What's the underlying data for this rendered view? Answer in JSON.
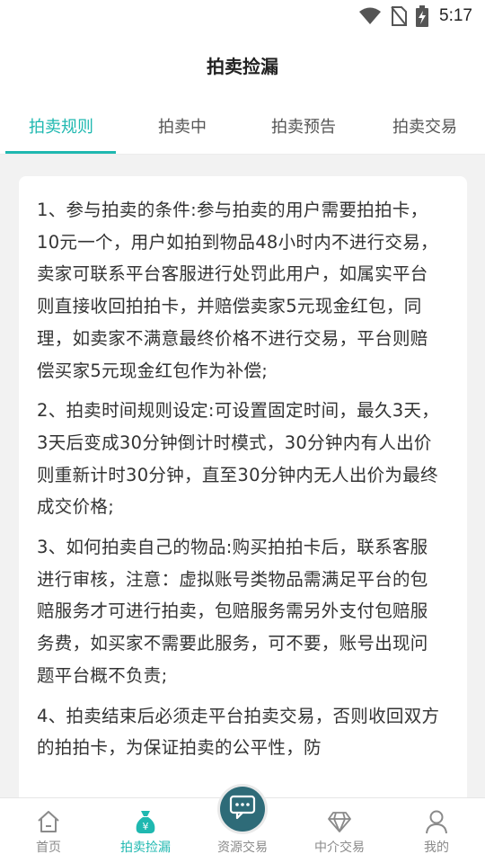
{
  "status_bar": {
    "time": "5:17",
    "icons": [
      "wifi-icon",
      "no-sim-icon",
      "battery-charging-icon"
    ]
  },
  "header": {
    "title": "拍卖捡漏"
  },
  "tabs": [
    {
      "label": "拍卖规则",
      "active": true
    },
    {
      "label": "拍卖中",
      "active": false
    },
    {
      "label": "拍卖预告",
      "active": false
    },
    {
      "label": "拍卖交易",
      "active": false
    }
  ],
  "rules": [
    "1、参与拍卖的条件:参与拍卖的用户需要拍拍卡，10元一个，用户如拍到物品48小时内不进行交易，卖家可联系平台客服进行处罚此用户，如属实平台则直接收回拍拍卡，并赔偿卖家5元现金红包，同理，如卖家不满意最终价格不进行交易，平台则赔偿买家5元现金红包作为补偿;",
    "2、拍卖时间规则设定:可设置固定时间，最久3天，3天后变成30分钟倒计时模式，30分钟内有人出价则重新计时30分钟，直至30分钟内无人出价为最终成交价格;",
    "3、如何拍卖自己的物品:购买拍拍卡后，联系客服进行审核，注意：虚拟账号类物品需满足平台的包赔服务才可进行拍卖，包赔服务需另外支付包赔服务费，如买家不需要此服务，可不要，账号出现问题平台概不负责;",
    "4、拍卖结束后必须走平台拍卖交易，否则收回双方的拍拍卡，为保证拍卖的公平性，防"
  ],
  "bottom_nav": [
    {
      "label": "首页",
      "icon": "home-icon",
      "active": false
    },
    {
      "label": "拍卖捡漏",
      "icon": "money-bag-icon",
      "active": true
    },
    {
      "label": "资源交易",
      "icon": "chat-bubble-icon",
      "active": false
    },
    {
      "label": "中介交易",
      "icon": "diamond-icon",
      "active": false
    },
    {
      "label": "我的",
      "icon": "user-icon",
      "active": false
    }
  ],
  "colors": {
    "accent": "#1fb8b0",
    "center_button": "#2e6b78"
  }
}
